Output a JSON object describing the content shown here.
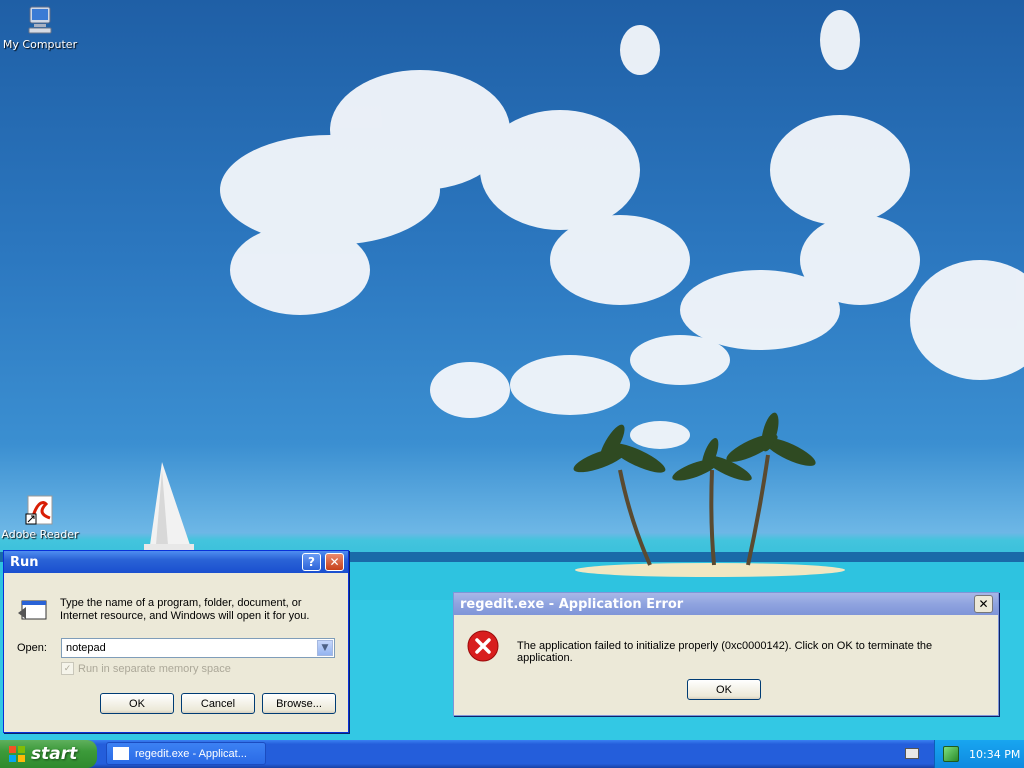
{
  "desktop": {
    "icons": [
      {
        "label": "My Computer"
      },
      {
        "label": "Adobe Reader"
      }
    ]
  },
  "run_dialog": {
    "title": "Run",
    "description": "Type the name of a program, folder, document, or Internet resource, and Windows will open it for you.",
    "open_label": "Open:",
    "open_value": "notepad",
    "checkbox_label": "Run in separate memory space",
    "ok_label": "OK",
    "cancel_label": "Cancel",
    "browse_label": "Browse..."
  },
  "error_dialog": {
    "title": "regedit.exe - Application Error",
    "message": "The application failed to initialize properly (0xc0000142). Click on OK to terminate the application.",
    "ok_label": "OK"
  },
  "taskbar": {
    "start_label": "start",
    "task_label": "regedit.exe - Applicat...",
    "clock": "10:34 PM"
  }
}
